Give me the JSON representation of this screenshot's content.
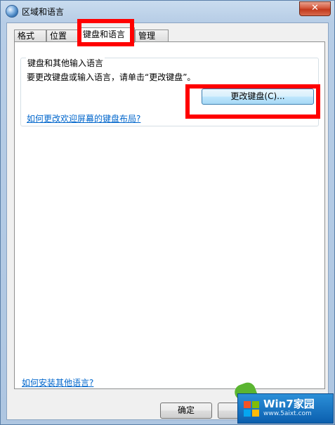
{
  "window": {
    "title": "区域和语言"
  },
  "tabs": [
    {
      "label": "格式"
    },
    {
      "label": "位置"
    },
    {
      "label": "键盘和语言"
    },
    {
      "label": "管理"
    }
  ],
  "group": {
    "title": "键盘和其他输入语言",
    "description": "要更改键盘或输入语言，请单击“更改键盘”。",
    "change_button": "更改键盘(C)...",
    "welcome_link": "如何更改欢迎屏幕的键盘布局?"
  },
  "footer": {
    "install_link": "如何安装其他语言?",
    "ok_button": "确定",
    "cancel_button": ""
  },
  "watermark": {
    "title": "Win7家园",
    "url": "www.5aixt.com"
  },
  "colors": {
    "highlight": "#ff0000",
    "link": "#0066cc",
    "close": "#c23a1d"
  }
}
